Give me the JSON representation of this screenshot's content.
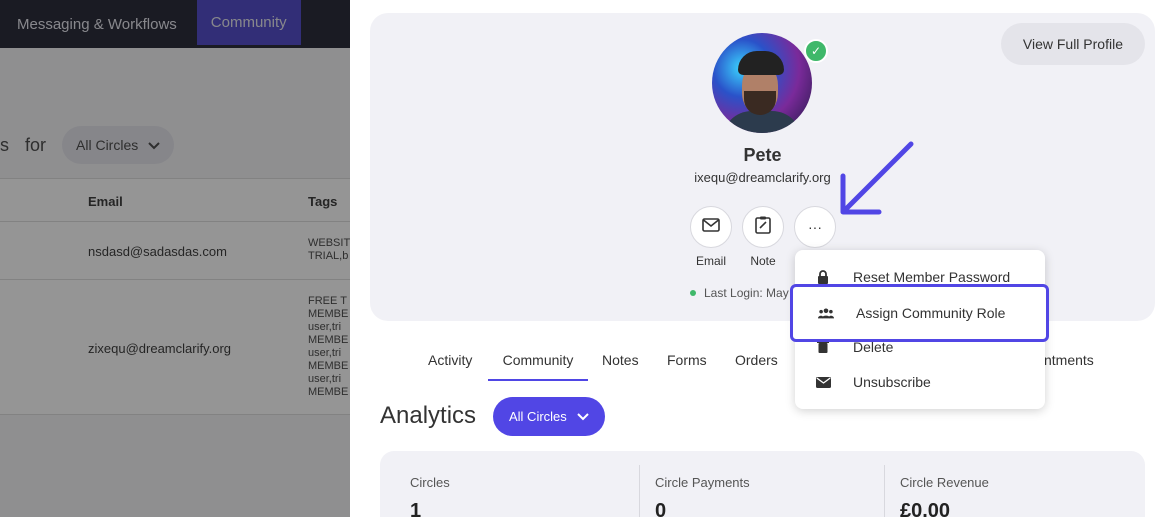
{
  "nav": {
    "items": [
      "Messaging & Workflows",
      "Community"
    ],
    "active": "Community"
  },
  "background": {
    "filter_prefix": "s",
    "filter_for": "for",
    "filter_value": "All Circles",
    "columns": [
      "Email",
      "Tags"
    ],
    "rows": [
      {
        "email": "nsdasd@sadasdas.com",
        "tags": [
          "WEBSIT",
          "TRIAL,b"
        ]
      },
      {
        "email": "zixequ@dreamclarify.org",
        "tags": [
          "FREE T",
          "MEMBE",
          "user,tri",
          "MEMBE",
          "user,tri",
          "MEMBE",
          "user,tri",
          "MEMBE"
        ]
      }
    ]
  },
  "profile": {
    "view_full_profile": "View Full Profile",
    "name": "Pete",
    "email": "ixequ@dreamclarify.org",
    "actions": {
      "email": "Email",
      "note": "Note",
      "more": "···"
    },
    "last_login": "Last Login: May"
  },
  "menu": {
    "items": [
      "Reset Member Password",
      "Assign Community Role",
      "Delete",
      "Unsubscribe"
    ]
  },
  "tabs": [
    "Activity",
    "Community",
    "Notes",
    "Forms",
    "Orders",
    "ntments"
  ],
  "active_tab": "Community",
  "analytics": {
    "title": "Analytics",
    "filter": "All Circles",
    "stats": [
      {
        "label": "Circles",
        "value": "1"
      },
      {
        "label": "Circle Payments",
        "value": "0"
      },
      {
        "label": "Circle Revenue",
        "value": "£0.00"
      }
    ]
  },
  "colors": {
    "accent": "#5146e5",
    "status_green": "#3fb86a"
  }
}
